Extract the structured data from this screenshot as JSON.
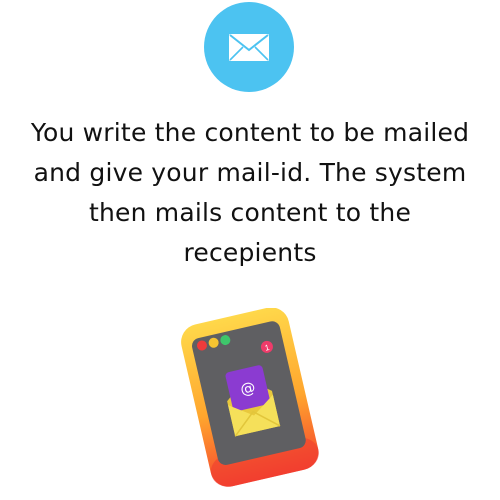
{
  "colors": {
    "badge": "#4cc3f1",
    "envelope_icon": "#ffffff",
    "text": "#111111",
    "phone_frame": "#f5a623",
    "phone_frame_edge": "#ef4a4a",
    "phone_screen": "#5f5f62",
    "dot_red": "#ef3b3b",
    "dot_yellow": "#f5c431",
    "dot_green": "#3ec66b",
    "notification": "#ef3b6a",
    "letter": "#8b3bd1",
    "envelope": "#f2dc4a"
  },
  "icons": {
    "badge_icon": "envelope-icon",
    "illustration": "phone-mail-illustration"
  },
  "description": {
    "line1": "You write the content to be mailed",
    "line2": "and give your mail-id. The system",
    "line3": "then mails content to the",
    "line4": "recepients"
  },
  "illustration": {
    "notification_count": "1",
    "letter_symbol": "@"
  }
}
